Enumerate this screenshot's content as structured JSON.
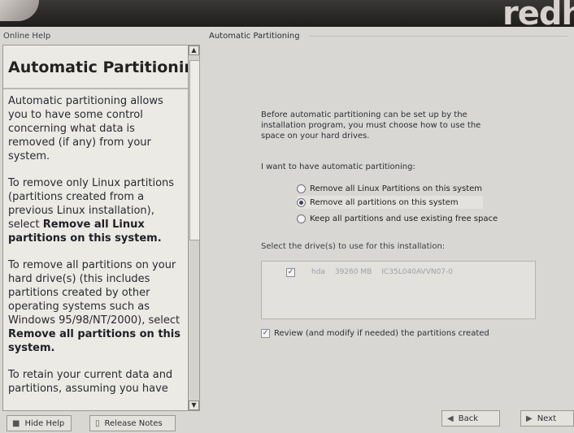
{
  "brand": {
    "text": "redha",
    "logo_icon": "redhat-swirl-logo"
  },
  "help": {
    "header": "Online Help",
    "title": "Automatic Partitioning",
    "paragraphs": [
      {
        "plain": "Automatic partitioning allows you to have some control concerning what data is removed (if any) from your system.",
        "bold": ""
      },
      {
        "plain": "To remove only Linux partitions (partitions created from a previous Linux installation), select ",
        "bold": "Remove all Linux partitions on this system."
      },
      {
        "plain": "To remove all partitions on your hard drive(s) (this includes partitions created by other operating systems such as Windows 95/98/NT/2000), select ",
        "bold": "Remove all partitions on this system."
      },
      {
        "plain": "To retain your current data and partitions, assuming you have",
        "bold": ""
      }
    ]
  },
  "main": {
    "header": "Automatic Partitioning",
    "intro": "Before automatic partitioning can be set up by the installation program, you must choose how to use the space on your hard drives.",
    "want_label": "I want to have automatic partitioning:",
    "options": [
      {
        "label": "Remove all Linux Partitions on this system",
        "selected": false
      },
      {
        "label": "Remove all partitions on this system",
        "selected": true
      },
      {
        "label": "Keep all partitions and use existing free space",
        "selected": false
      }
    ],
    "drives_label": "Select the drive(s) to use for this installation:",
    "drives": [
      {
        "checked": true,
        "name": "hda",
        "size": "39260 MB",
        "model": "IC35L040AVVN07-0"
      }
    ],
    "review_checked": true,
    "review_label": "Review (and modify if needed) the partitions created"
  },
  "buttons": {
    "hide_help": "Hide Help",
    "release_notes": "Release Notes",
    "back": "Back",
    "next": "Next"
  }
}
